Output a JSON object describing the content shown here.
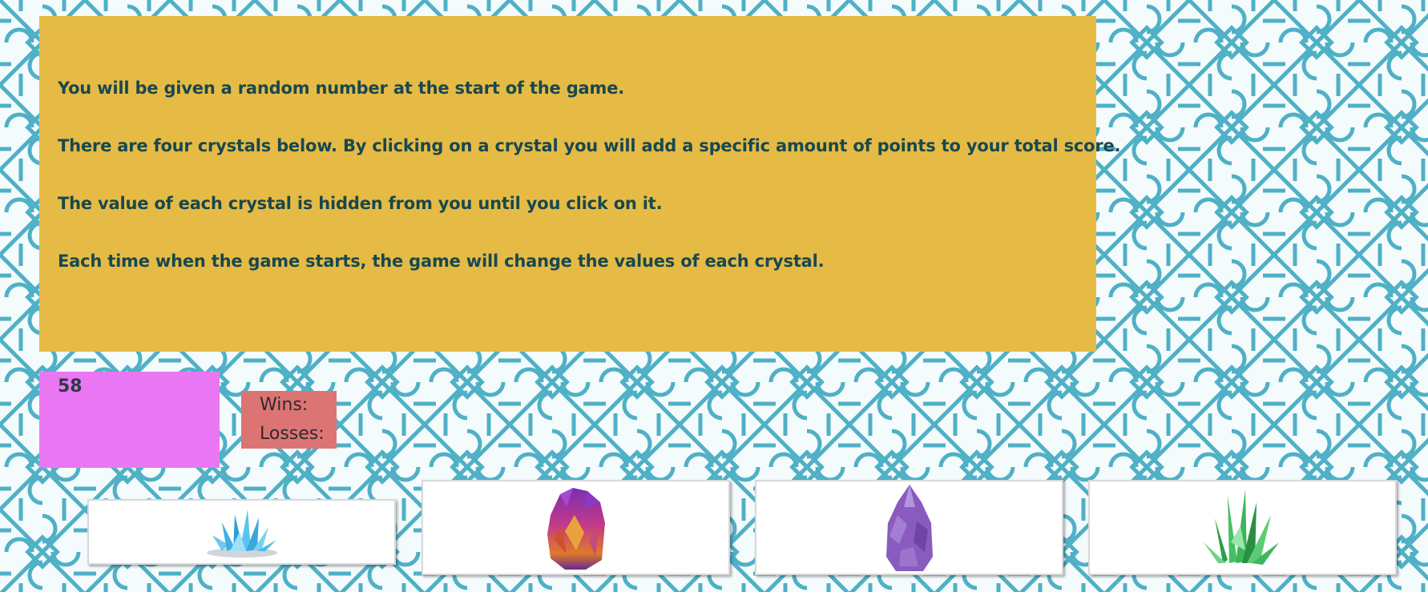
{
  "instructions": {
    "line1": "You will be given a random number at the start of the game.",
    "line2": "There are four crystals below. By clicking on a crystal you will add a specific amount of points to your total score.",
    "line3": "The value of each crystal is hidden from you until you click on it.",
    "line4": "Each time when the game starts, the game will change the values of each crystal."
  },
  "target": {
    "number": "58"
  },
  "scoreboard": {
    "wins_label": "Wins:",
    "losses_label": "Losses:"
  },
  "crystals": [
    {
      "name": "blue-crystal",
      "icon": "blue-crystal-cluster-icon",
      "color": "#3fb7e6"
    },
    {
      "name": "orange-purple-crystal",
      "icon": "rainbow-crystal-icon",
      "color": "#c2398a"
    },
    {
      "name": "purple-crystal",
      "icon": "amethyst-point-icon",
      "color": "#8a5bbf"
    },
    {
      "name": "green-crystal",
      "icon": "green-crystal-cluster-icon",
      "color": "#3cb55a"
    }
  ],
  "colors": {
    "instructions_bg": "#e6bb45",
    "instructions_text": "#18484f",
    "target_bg": "#e977f3",
    "score_bg": "#dd7474",
    "pattern": "#4fb0c6"
  }
}
